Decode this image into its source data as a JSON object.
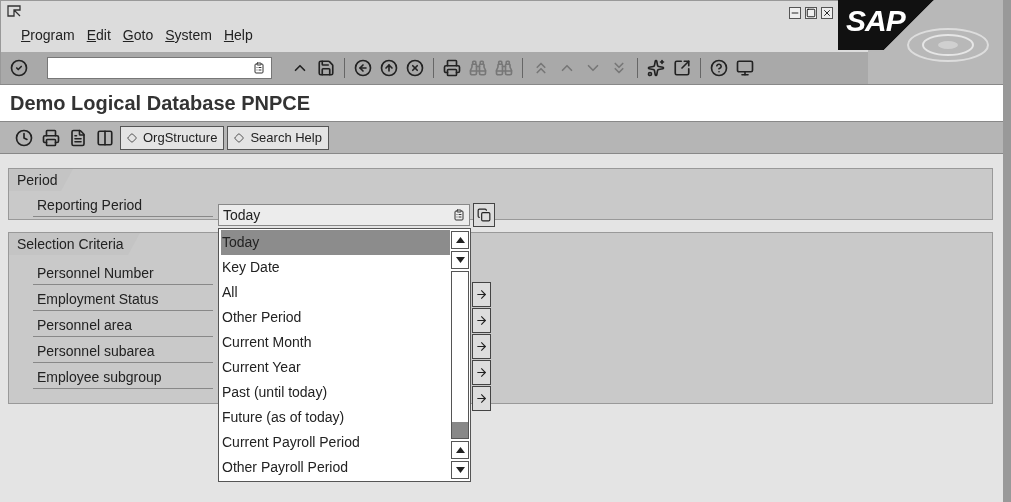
{
  "menu": [
    {
      "label": "Program"
    },
    {
      "label": "Edit"
    },
    {
      "label": "Goto"
    },
    {
      "label": "System"
    },
    {
      "label": "Help"
    }
  ],
  "logo": "SAP",
  "title": "Demo Logical Database PNPCE",
  "app_toolbar": {
    "buttons": [
      {
        "label": "OrgStructure"
      },
      {
        "label": "Search Help"
      }
    ]
  },
  "period": {
    "title": "Period",
    "field": {
      "label": "Reporting Period",
      "value": "Today"
    }
  },
  "selection_criteria": {
    "title": "Selection Criteria",
    "fields": [
      {
        "label": "Personnel Number"
      },
      {
        "label": "Employment Status"
      },
      {
        "label": "Personnel area"
      },
      {
        "label": "Personnel subarea"
      },
      {
        "label": "Employee subgroup"
      }
    ]
  },
  "dropdown": {
    "options": [
      {
        "label": "Today",
        "selected": true
      },
      {
        "label": "Key Date",
        "selected": false
      },
      {
        "label": "All",
        "selected": false
      },
      {
        "label": "Other Period",
        "selected": false
      },
      {
        "label": "Current Month",
        "selected": false
      },
      {
        "label": "Current Year",
        "selected": false
      },
      {
        "label": "Past (until today)",
        "selected": false
      },
      {
        "label": "Future (as of today)",
        "selected": false
      },
      {
        "label": "Current Payroll Period",
        "selected": false
      },
      {
        "label": "Other Payroll Period",
        "selected": false
      }
    ]
  }
}
